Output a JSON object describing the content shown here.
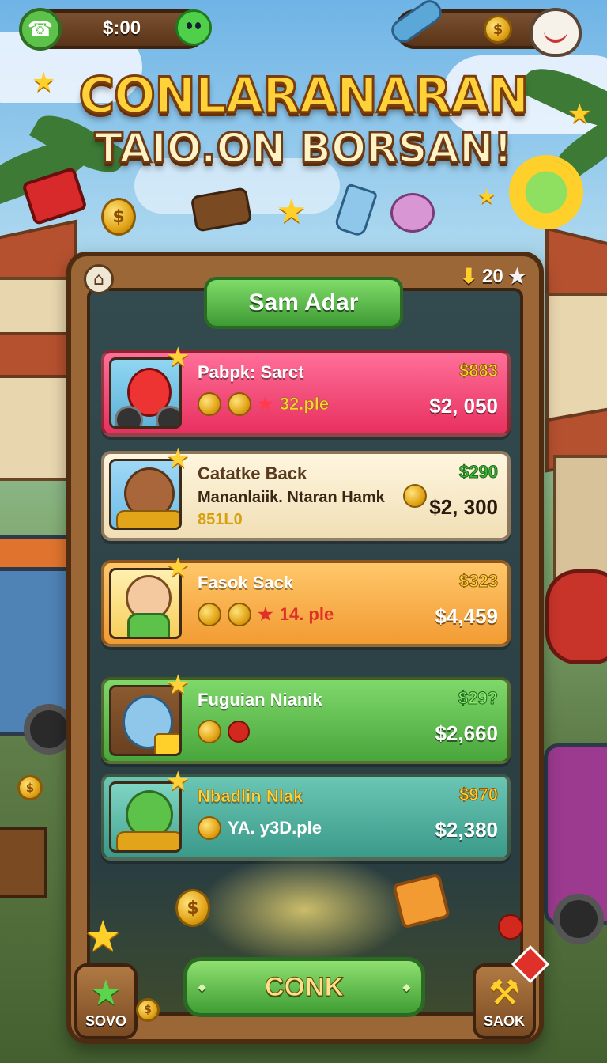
{
  "topbar_left": {
    "money": "$:00",
    "phone_icon": "phone-icon",
    "slime_icon": "slime-icon"
  },
  "topbar_right": {
    "coin_symbol": "$",
    "bone_icon": "bone-icon",
    "cat_icon": "cat-face-icon"
  },
  "title": {
    "line1": "CONLARANARAN",
    "line2": "TAIO.ON BORSAN!"
  },
  "board": {
    "counter": "20",
    "header": "Sam Adar",
    "cards": [
      {
        "name": "Pabpk: Sarct",
        "price_top": "$883",
        "price_main": "$2, 050",
        "label": "32.ple"
      },
      {
        "name": "Catatke Back",
        "sub": "Mananlaiik. Ntaran Hamk",
        "extra": "851L0",
        "price_top": "$290",
        "price_main": "$2, 300"
      },
      {
        "name": "Fasok Sack",
        "price_top": "$323",
        "price_main": "$4,459",
        "label": "14. ple"
      },
      {
        "name": "Fuguian Nianik",
        "price_top": "$29?",
        "price_main": "$2,660"
      },
      {
        "name": "Nbadlin Nlak",
        "price_top": "$970",
        "price_main": "$2,380",
        "label": "YA. y3D.ple"
      }
    ]
  },
  "buttons": {
    "main": "CONK",
    "left": "SOVO",
    "right": "SAOK"
  },
  "colors": {
    "pink_card": "#e8305f",
    "cream_card": "#f0dfb5",
    "orange_card": "#f29b33",
    "green_card": "#49a63c",
    "teal_card": "#3a9a8a",
    "wood": "#9b6736"
  }
}
